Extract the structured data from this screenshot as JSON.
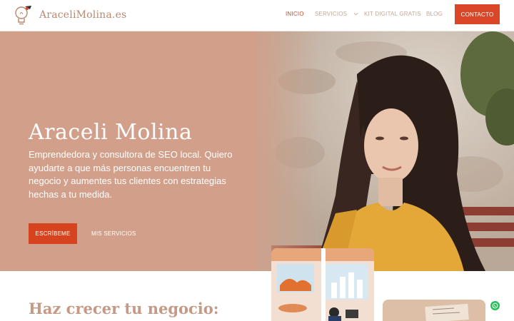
{
  "header": {
    "logo_text": "AraceliMolina.es",
    "nav": {
      "inicio": "INICIO",
      "servicios": "SERVICIOS",
      "kit_digital": "KIT DIGITAL GRATIS",
      "blog": "BLOG",
      "contacto": "CONTACTO"
    }
  },
  "hero": {
    "title": "Araceli Molina",
    "subtitle": "Emprendedora y consultora de SEO local. Quiero ayudarte a que más personas encuentren tu negocio y aumentes tus clientes con estrategias hechas a tu medida.",
    "primary_button": "ESCRÍBEME",
    "secondary_button": "MIS SERVICIOS"
  },
  "section": {
    "title": "Haz crecer tu negocio:"
  },
  "icons": [
    "logo-lightbulb-icon",
    "chevron-down-icon",
    "whatsapp-icon"
  ],
  "colors": {
    "accent": "#d94726",
    "hero_bg": "#d2a08a",
    "nav_text": "#c2a898",
    "heading": "#c49a86"
  }
}
